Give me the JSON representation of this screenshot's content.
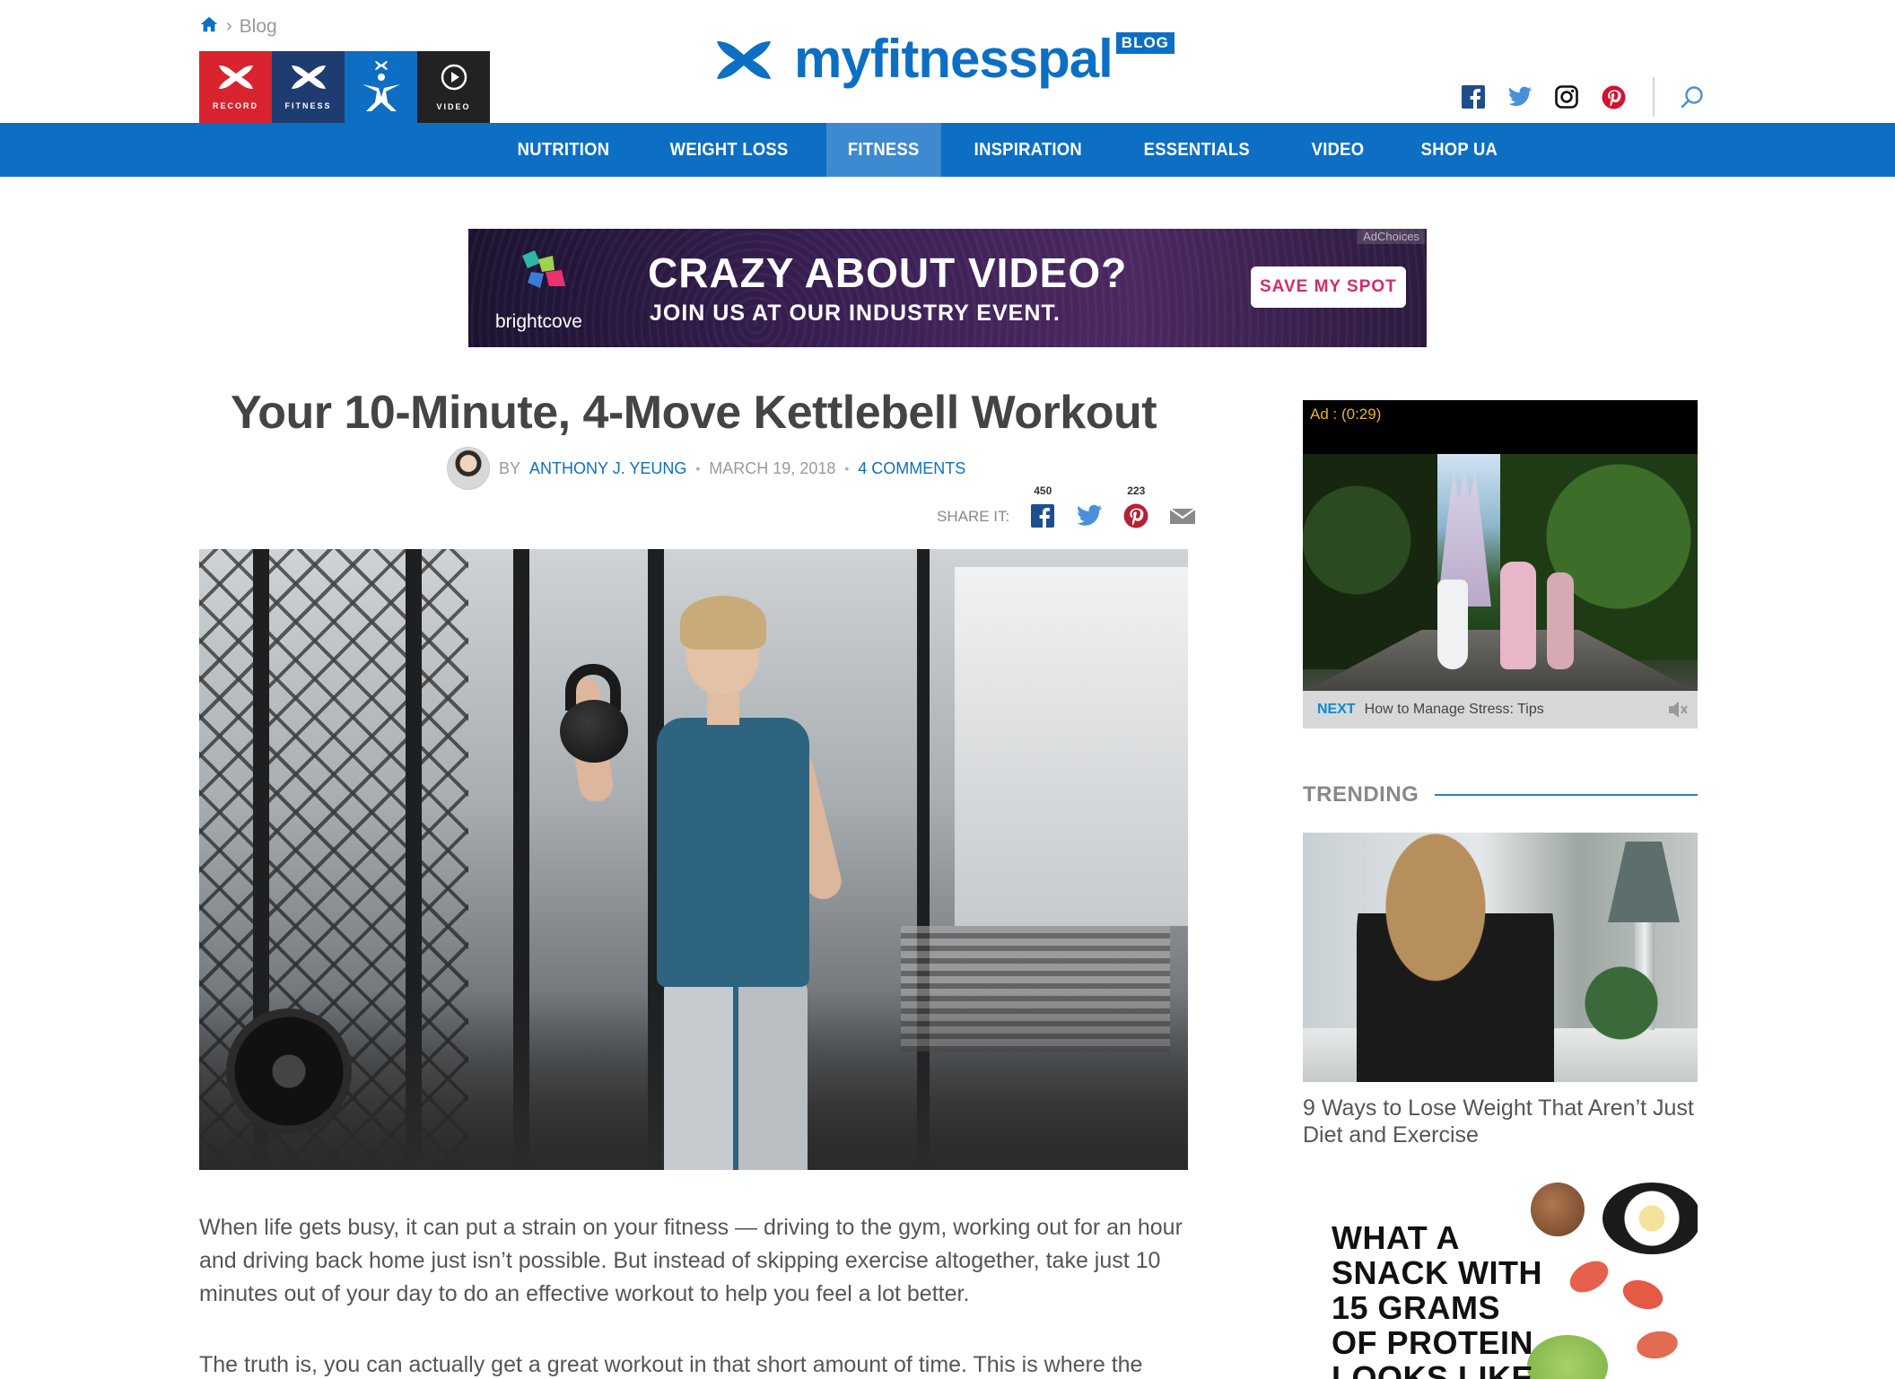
{
  "breadcrumb": {
    "current": "Blog"
  },
  "apps": [
    {
      "label": "RECORD"
    },
    {
      "label": "FITNESS"
    },
    {
      "label": ""
    },
    {
      "label": "VIDEO"
    }
  ],
  "logo": {
    "wordmark": "myfitnesspal",
    "tag": "BLOG"
  },
  "nav": {
    "items": [
      "NUTRITION",
      "WEIGHT LOSS",
      "FITNESS",
      "INSPIRATION",
      "ESSENTIALS",
      "VIDEO",
      "SHOP UA"
    ],
    "active": "FITNESS"
  },
  "banner_ad": {
    "brand": "brightcove",
    "headline": "CRAZY ABOUT VIDEO?",
    "subhead": "JOIN US AT OUR INDUSTRY EVENT.",
    "cta": "SAVE MY SPOT",
    "adchoices": "AdChoices"
  },
  "article": {
    "title": "Your 10-Minute, 4-Move Kettlebell Workout",
    "by_prefix": "BY",
    "author": "ANTHONY J. YEUNG",
    "date": "MARCH 19, 2018",
    "comments": "4 COMMENTS",
    "share_label": "SHARE IT:",
    "share_counts": {
      "facebook": "450",
      "pinterest": "223"
    },
    "paragraphs": [
      "When life gets busy, it can put a strain on your fitness — driving to the gym, working out for an hour and driving back home just isn’t possible. But instead of skipping exercise altogether, take just 10 minutes out of your day to do an effective workout to help you feel a lot better.",
      "The truth is, you can actually get a great workout in that short amount of time. This is  where the"
    ]
  },
  "sidebar": {
    "video_ad": {
      "ad_label": "Ad : (0:29)",
      "next_label": "NEXT",
      "next_title": "How to Manage Stress: Tips"
    },
    "trending": {
      "heading": "TRENDING",
      "story_title": "9 Ways to Lose Weight That Aren’t Just Diet and Exercise"
    },
    "promo": {
      "lines": [
        "WHAT A",
        "SNACK WITH",
        "15 GRAMS",
        "OF PROTEIN",
        "LOOKS LIKE"
      ]
    }
  },
  "colors": {
    "brand_blue": "#0d6fc4",
    "nav_active": "#3e8ad1",
    "record_red": "#d9232e",
    "cta_pink": "#d32a6a"
  }
}
